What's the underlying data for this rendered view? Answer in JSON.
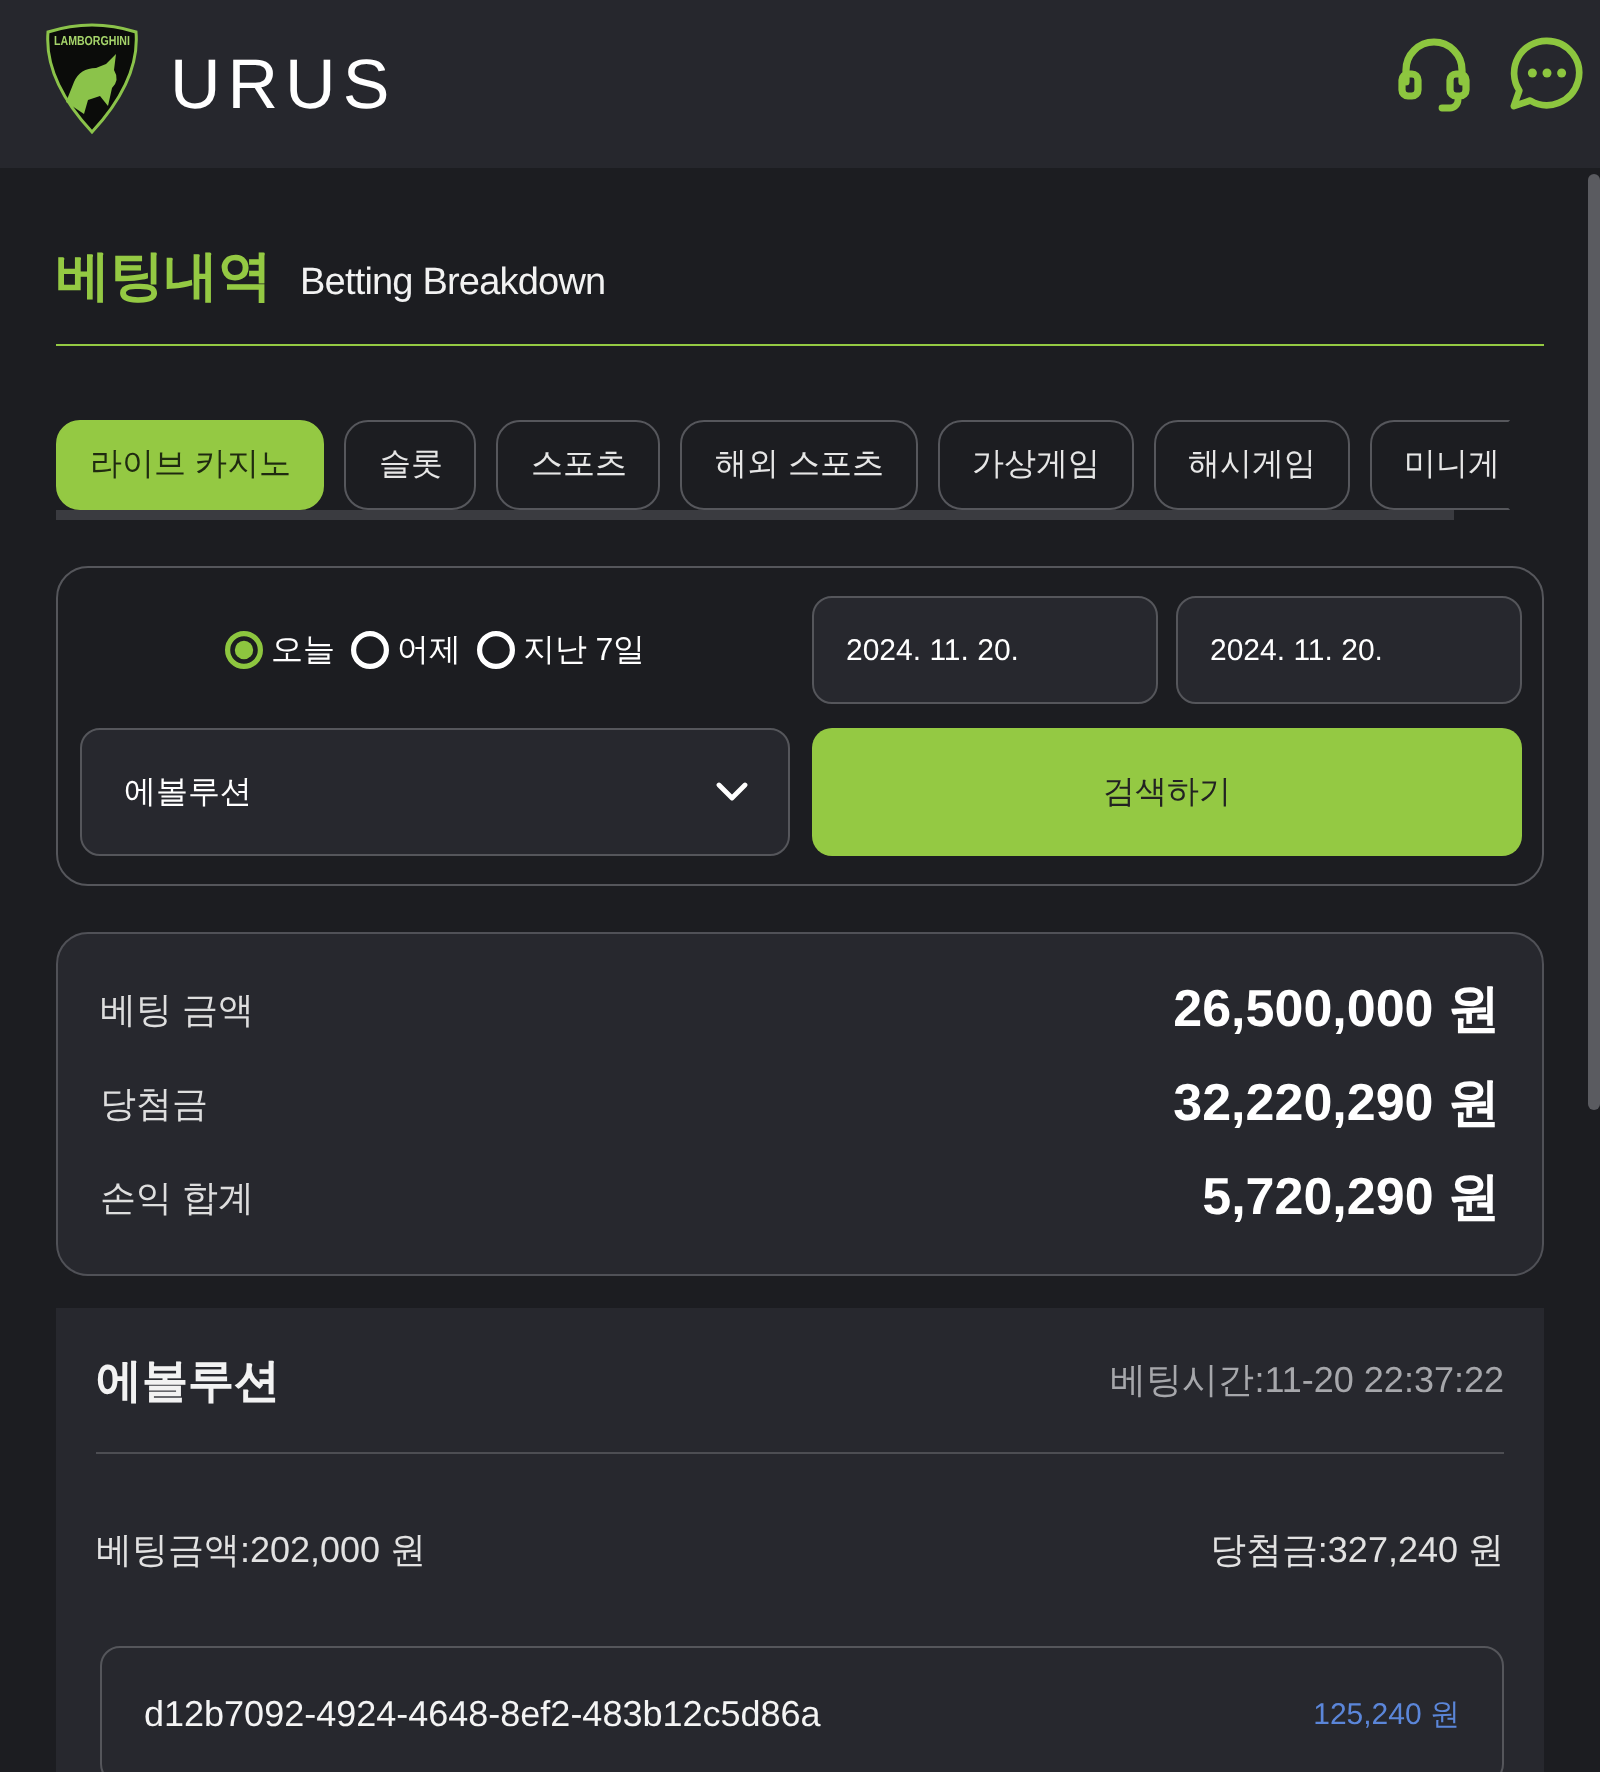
{
  "header": {
    "logo_text": "LAMBORGHINI",
    "brand": "URUS"
  },
  "page_title": {
    "title": "베팅내역",
    "subtitle": "Betting Breakdown"
  },
  "tabs": [
    {
      "label": "라이브 카지노",
      "selected": true
    },
    {
      "label": "슬롯",
      "selected": false
    },
    {
      "label": "스포츠",
      "selected": false
    },
    {
      "label": "해외 스포츠",
      "selected": false
    },
    {
      "label": "가상게임",
      "selected": false
    },
    {
      "label": "해시게임",
      "selected": false
    },
    {
      "label": "미니게",
      "selected": false
    }
  ],
  "filter": {
    "date_ranges": [
      {
        "label": "오늘",
        "selected": true
      },
      {
        "label": "어제",
        "selected": false
      },
      {
        "label": "지난 7일",
        "selected": false
      }
    ],
    "start_date": "2024. 11. 20.",
    "end_date": "2024. 11. 20.",
    "game_select": "에볼루션",
    "search_button": "검색하기"
  },
  "summary": [
    {
      "label": "베팅 금액",
      "value": "26,500,000 원"
    },
    {
      "label": "당첨금",
      "value": "32,220,290 원"
    },
    {
      "label": "손익 합계",
      "value": "5,720,290 원"
    }
  ],
  "records": [
    {
      "game": "에볼루션",
      "bet_time": "베팅시간:11-20 22:37:22",
      "bet_amount": "베팅금액:202,000 원",
      "win_amount": "당첨금:327,240 원",
      "rounds": [
        {
          "id": "d12b7092-4924-4648-8ef2-483b12c5d86a",
          "amount": "125,240 원"
        }
      ]
    }
  ]
}
